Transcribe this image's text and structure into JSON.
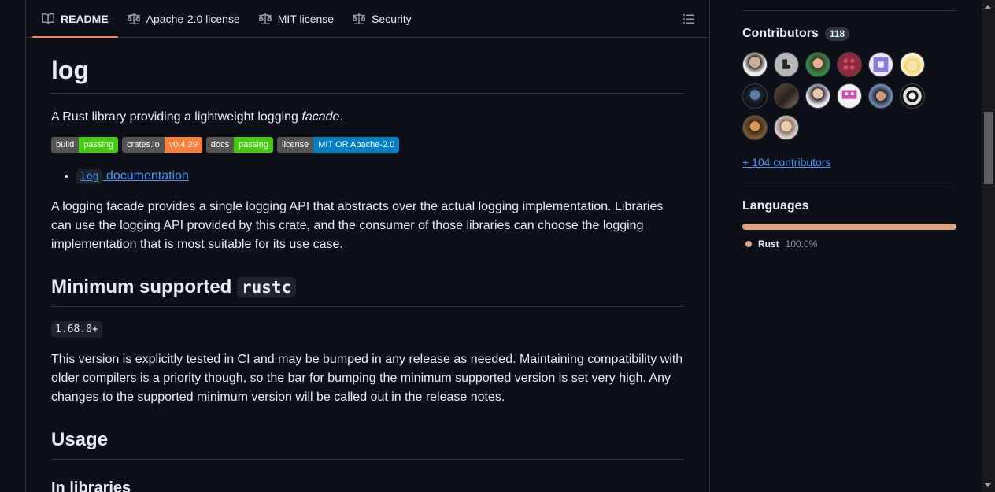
{
  "tabs": [
    {
      "label": "README",
      "icon": "book-icon"
    },
    {
      "label": "Apache-2.0 license",
      "icon": "scale-icon"
    },
    {
      "label": "MIT license",
      "icon": "scale-icon"
    },
    {
      "label": "Security",
      "icon": "scale-icon"
    }
  ],
  "readme": {
    "title": "log",
    "lead_prefix": "A Rust library providing a lightweight logging ",
    "lead_em": "facade",
    "lead_suffix": ".",
    "badges": [
      {
        "label": "build",
        "value": "passing",
        "color": "#4c1"
      },
      {
        "label": "crates.io",
        "value": "v0.4.29",
        "color": "#fe7d37"
      },
      {
        "label": "docs",
        "value": "passing",
        "color": "#4c1"
      },
      {
        "label": "license",
        "value": "MIT OR Apache-2.0",
        "color": "#007ec6"
      }
    ],
    "doc_link_code": "log",
    "doc_link_text": " documentation",
    "para1": "A logging facade provides a single logging API that abstracts over the actual logging implementation. Libraries can use the logging API provided by this crate, and the consumer of those libraries can choose the logging implementation that is most suitable for its use case.",
    "h2_msrv_text": "Minimum supported ",
    "h2_msrv_code": "rustc",
    "msrv_version": "1.68.0+",
    "para2": "This version is explicitly tested in CI and may be bumped in any release as needed. Maintaining compatibility with older compilers is a priority though, so the bar for bumping the minimum supported version is set very high. Any changes to the supported minimum version will be called out in the release notes.",
    "h2_usage": "Usage",
    "h3_libraries": "In libraries"
  },
  "sidebar": {
    "contributors_title": "Contributors",
    "contributors_count": "118",
    "more_contributors": "+ 104 contributors",
    "languages_title": "Languages",
    "language": {
      "name": "Rust",
      "percent": "100.0%",
      "color": "#dea584"
    }
  },
  "colors": {
    "accent_tab": "#f78166",
    "link": "#4493f8",
    "background": "#0d1117",
    "border": "#30363d"
  }
}
